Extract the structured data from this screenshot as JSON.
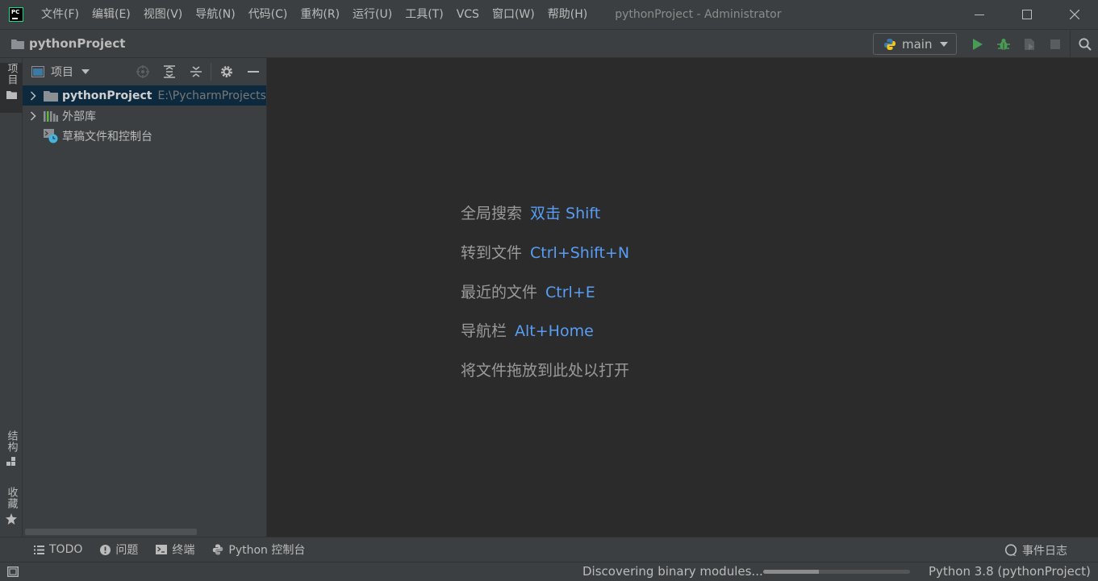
{
  "titlebar": {
    "logo_text": "PC",
    "menu": [
      "文件(F)",
      "编辑(E)",
      "视图(V)",
      "导航(N)",
      "代码(C)",
      "重构(R)",
      "运行(U)",
      "工具(T)",
      "VCS",
      "窗口(W)",
      "帮助(H)"
    ],
    "window_title": "pythonProject - Administrator"
  },
  "navbar": {
    "project_name": "pythonProject",
    "run_config": "main"
  },
  "left_strip": {
    "project_tab": "项目",
    "structure_tab": "结构",
    "favorites_tab": "收藏"
  },
  "project_panel": {
    "title": "项目",
    "tree": [
      {
        "label": "pythonProject",
        "path": "E:\\PycharmProjects"
      },
      {
        "label": "外部库"
      },
      {
        "label": "草稿文件和控制台"
      }
    ]
  },
  "editor": {
    "hints": [
      {
        "label": "全局搜索",
        "key": "双击 Shift"
      },
      {
        "label": "转到文件",
        "key": "Ctrl+Shift+N"
      },
      {
        "label": "最近的文件",
        "key": "Ctrl+E"
      },
      {
        "label": "导航栏",
        "key": "Alt+Home"
      },
      {
        "label": "将文件拖放到此处以打开",
        "key": ""
      }
    ]
  },
  "bottom_tools": {
    "todo": "TODO",
    "problems": "问题",
    "terminal": "终端",
    "python_console": "Python 控制台",
    "event_log": "事件日志"
  },
  "statusbar": {
    "message": "Discovering binary modules...",
    "progress": 0.38,
    "interpreter": "Python 3.8 (pythonProject)"
  },
  "colors": {
    "accent_blue": "#589df6",
    "run_green": "#499c54",
    "folder": "#8c9095"
  }
}
